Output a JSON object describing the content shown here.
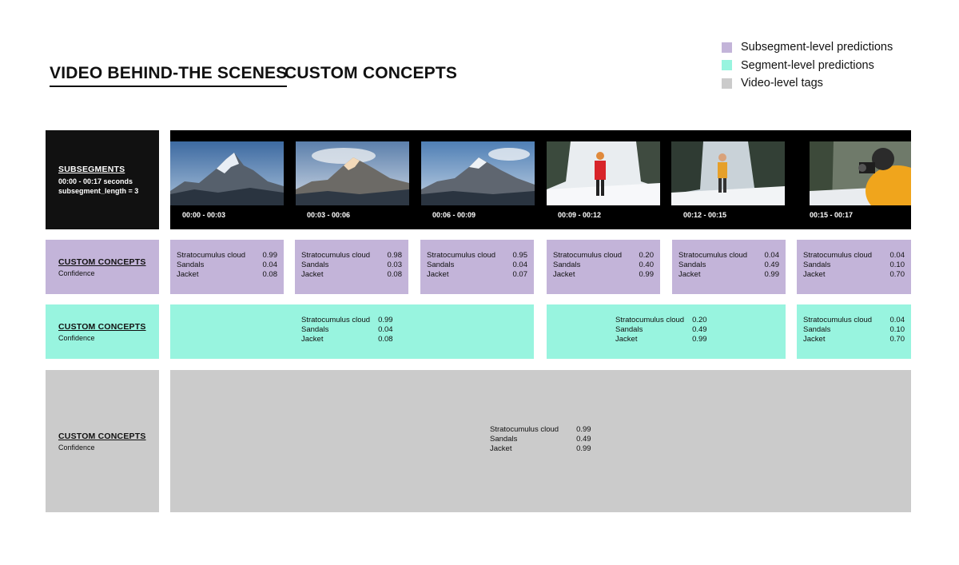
{
  "tabs": [
    {
      "label": "VIDEO BEHIND-THE SCENES"
    },
    {
      "label": "CUSTOM CONCEPTS"
    }
  ],
  "legend": [
    {
      "label": "Subsegment-level predictions",
      "color": "#c3b4d9"
    },
    {
      "label": "Segment-level predictions",
      "color": "#98f4df"
    },
    {
      "label": "Video-level tags",
      "color": "#cbcbcb"
    }
  ],
  "subsegments_label": {
    "title": "SUBSEGMENTS",
    "range": "00:00 - 00:17 seconds",
    "length": "subsegment_length = 3"
  },
  "frames": [
    {
      "time": "00:00 - 00:03",
      "scene": "mountain"
    },
    {
      "time": "00:03 - 00:06",
      "scene": "mountain"
    },
    {
      "time": "00:06 - 00:09",
      "scene": "mountain"
    },
    {
      "time": "00:09 - 00:12",
      "scene": "snowy-trail-red-jacket"
    },
    {
      "time": "00:12 - 00:15",
      "scene": "snowy-forest-yellow-jacket"
    },
    {
      "time": "00:15 - 00:17",
      "scene": "photographer-yellow-jacket"
    }
  ],
  "concept_label": {
    "title": "CUSTOM CONCEPTS",
    "sub": "Confidence"
  },
  "concepts": [
    "Stratocumulus cloud",
    "Sandals",
    "Jacket"
  ],
  "subsegment_predictions": [
    [
      "0.99",
      "0.04",
      "0.08"
    ],
    [
      "0.98",
      "0.03",
      "0.08"
    ],
    [
      "0.95",
      "0.04",
      "0.07"
    ],
    [
      "0.20",
      "0.40",
      "0.99"
    ],
    [
      "0.04",
      "0.49",
      "0.99"
    ],
    [
      "0.04",
      "0.10",
      "0.70"
    ]
  ],
  "segment_predictions": [
    [
      "0.99",
      "0.04",
      "0.08"
    ],
    [
      "0.20",
      "0.49",
      "0.99"
    ],
    [
      "0.04",
      "0.10",
      "0.70"
    ]
  ],
  "video_tags": [
    "0.99",
    "0.49",
    "0.99"
  ]
}
